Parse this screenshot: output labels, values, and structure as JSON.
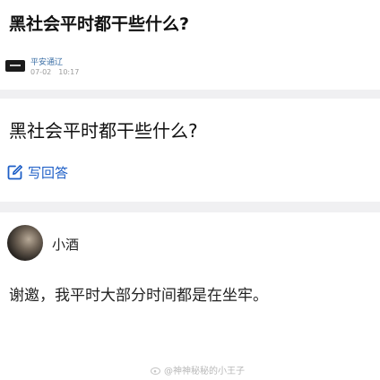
{
  "post": {
    "title": "黑社会平时都干些什么?",
    "source": {
      "name": "平安通辽",
      "date": "07-02",
      "time": "10:17"
    }
  },
  "question": {
    "title": "黑社会平时都干些什么?",
    "write_answer_label": "写回答",
    "write_icon": "edit-icon"
  },
  "answer": {
    "author": "小酒",
    "text": "谢邀，我平时大部分时间都是在坐牢。"
  },
  "watermark": "@神神秘秘的小王子",
  "colors": {
    "accent": "#1e5fc7",
    "source_link": "#3a6ea5",
    "divider": "#f0f0f2"
  }
}
